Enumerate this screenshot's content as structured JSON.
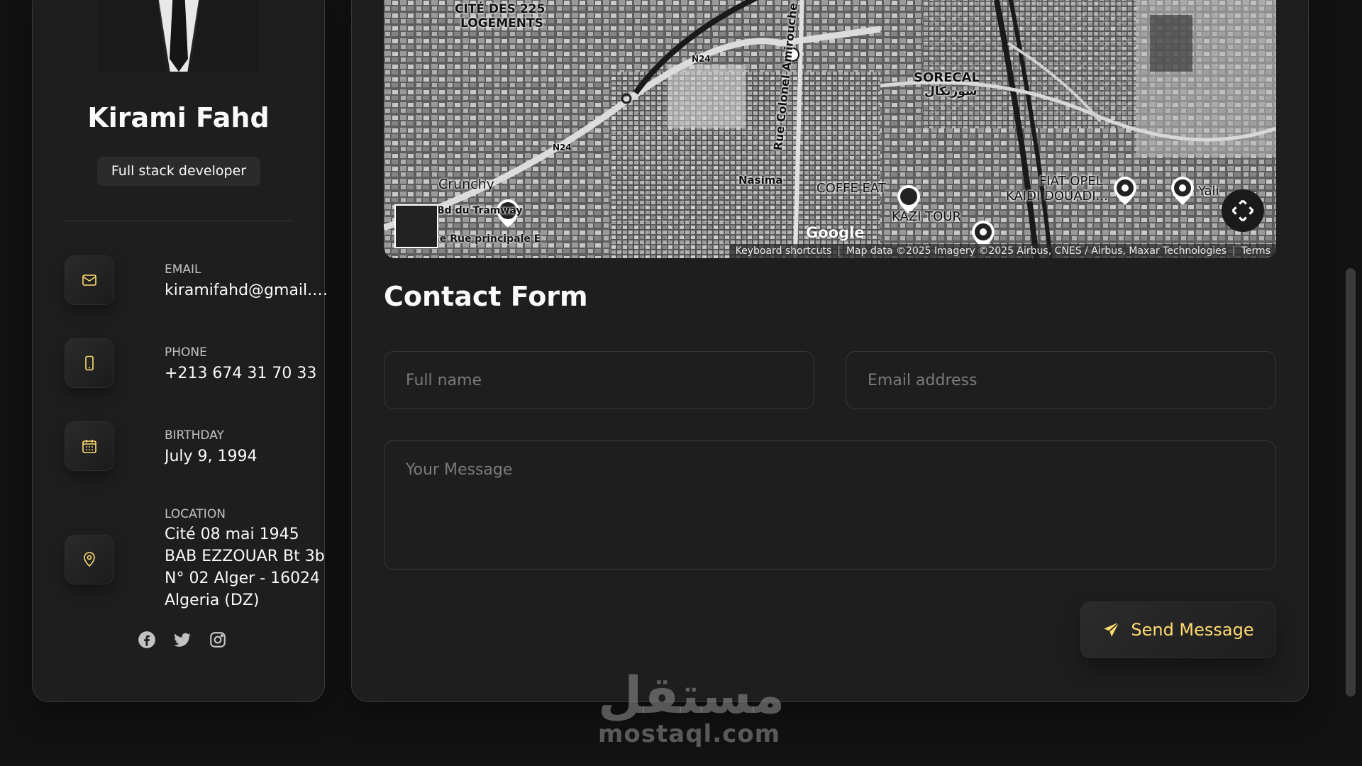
{
  "profile": {
    "name": "Kirami Fahd",
    "title": "Full stack developer"
  },
  "contacts": [
    {
      "label": "EMAIL",
      "value": "kiramifahd@gmail.c...",
      "icon": "mail-icon"
    },
    {
      "label": "PHONE",
      "value": "+213 674 31 70 33",
      "icon": "phone-icon"
    },
    {
      "label": "BIRTHDAY",
      "value": "July 9, 1994",
      "icon": "calendar-icon"
    },
    {
      "label": "LOCATION",
      "value": "Cité 08 mai 1945 BAB EZZOUAR Bt 3b N° 02 Alger - 16024 Algeria (DZ)",
      "icon": "location-pin-icon"
    }
  ],
  "socials": [
    "facebook-icon",
    "twitter-icon",
    "instagram-icon"
  ],
  "map": {
    "labels": {
      "cite": "CITÉ DES 225",
      "logements": "LOGEMENTS",
      "sorecal": "SORECAL",
      "sorecal_ar": "سوريكال",
      "crunchy": "Crunchy",
      "tramway": "Bd du Tramway",
      "principale": "2ème Rue principale E",
      "nasima": "Nasima",
      "coffe": "COFFE EAT",
      "kazi": "KAZI TOUR",
      "fiat": "FIAT OPEL",
      "kaidi": "KAIDI DOUADI...",
      "yali": "Yali",
      "amirouche": "Rue Colonel Amirouche",
      "n24a": "N24",
      "n24b": "N24",
      "google": "Google"
    },
    "attribution": {
      "shortcuts": "Keyboard shortcuts",
      "data": "Map data ©2025 Imagery ©2025 Airbus, CNES / Airbus, Maxar Technologies",
      "terms": "Terms"
    }
  },
  "form": {
    "title": "Contact Form",
    "fullname_placeholder": "Full name",
    "email_placeholder": "Email address",
    "message_placeholder": "Your Message",
    "send_label": "Send Message"
  },
  "watermark": {
    "arabic": "مستقل",
    "latin": "mostaql.com"
  },
  "colors": {
    "accent": "#ffdb70",
    "background": "#121212",
    "panel": "#1e1e1f"
  }
}
